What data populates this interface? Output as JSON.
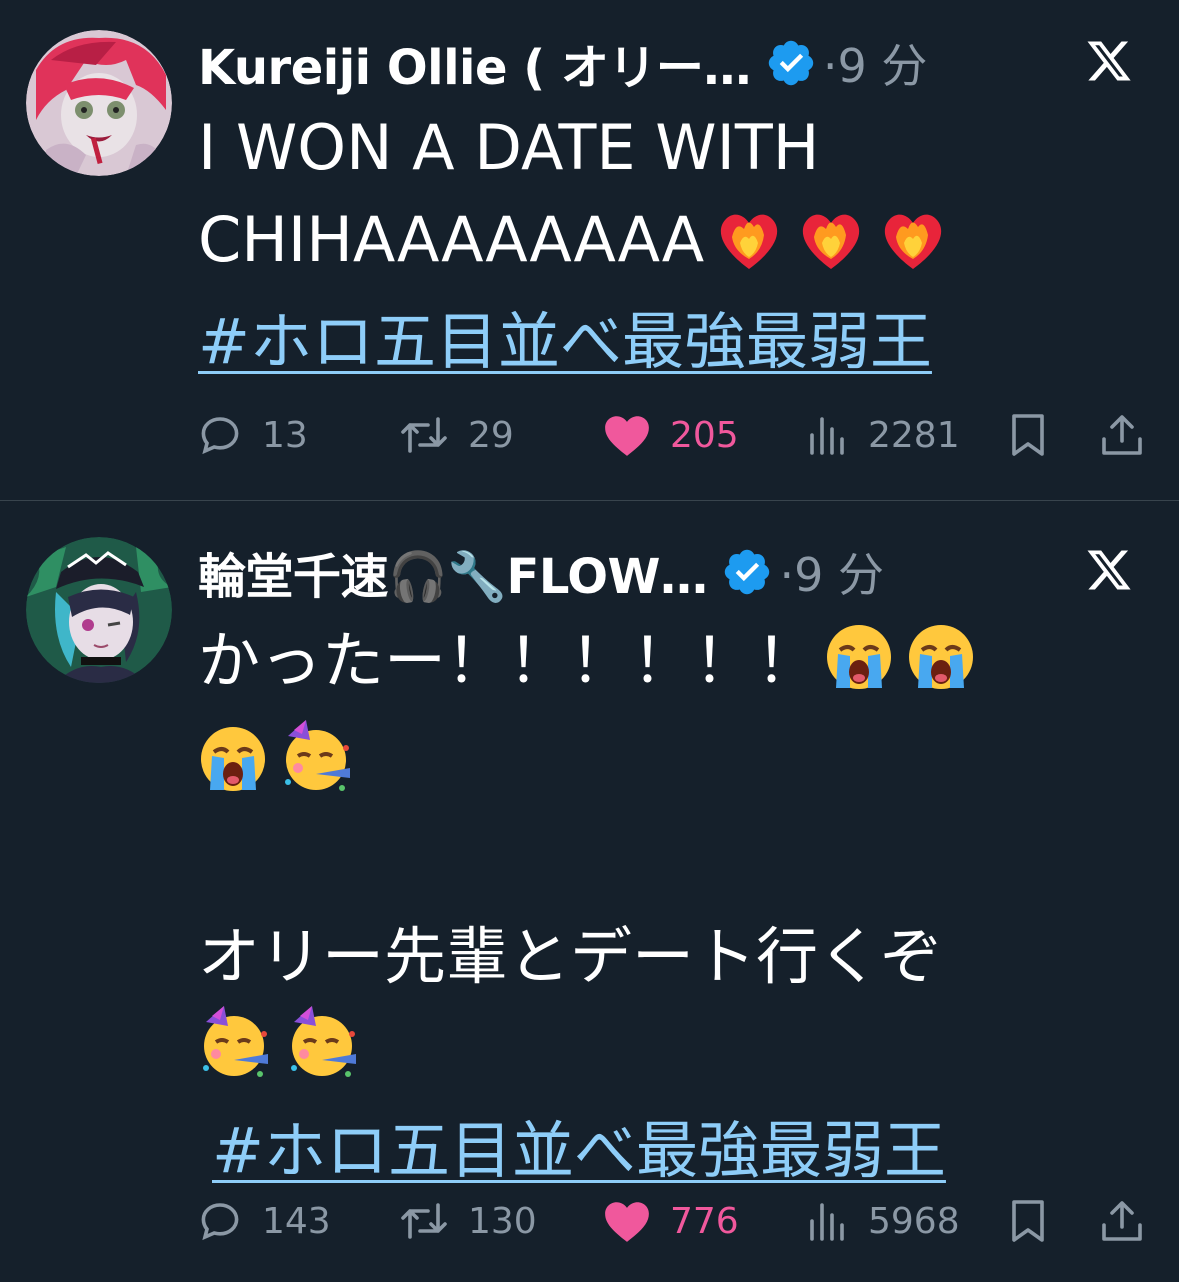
{
  "colors": {
    "background": "#15202b",
    "text": "#ffffff",
    "secondary": "#8b98a5",
    "hashtag": "#8ecdf8",
    "verified": "#1d9bf0",
    "like": "#f0589c",
    "divider": "#38444d"
  },
  "tweets": [
    {
      "author": "Kureiji Ollie ( オリー…",
      "time": "·9 分",
      "verified_icon": "verified-badge-icon",
      "platform_icon": "x-logo-icon",
      "text_line1": "I WON A DATE WITH",
      "text_line2": "CHIHAAAAAAAA",
      "emojis": [
        "heart-on-fire-emoji",
        "heart-on-fire-emoji",
        "heart-on-fire-emoji"
      ],
      "hashtag": "#ホロ五目並べ最強最弱王",
      "stats": {
        "replies": "13",
        "reposts": "29",
        "likes": "205",
        "views": "2281"
      }
    },
    {
      "author": "輪堂千速🎧🔧FLOW…",
      "time": "·9 分",
      "verified_icon": "verified-badge-icon",
      "platform_icon": "x-logo-icon",
      "text_line1": "かったー！！！！！！",
      "text_line3": "オリー先輩とデート行くぞ",
      "emojis": [
        "loudly-crying-emoji",
        "loudly-crying-emoji",
        "loudly-crying-emoji",
        "partying-face-emoji",
        "partying-face-emoji",
        "partying-face-emoji"
      ],
      "hashtag": "#ホロ五目並べ最強最弱王",
      "stats": {
        "replies": "143",
        "reposts": "130",
        "likes": "776",
        "views": "5968"
      }
    }
  ]
}
